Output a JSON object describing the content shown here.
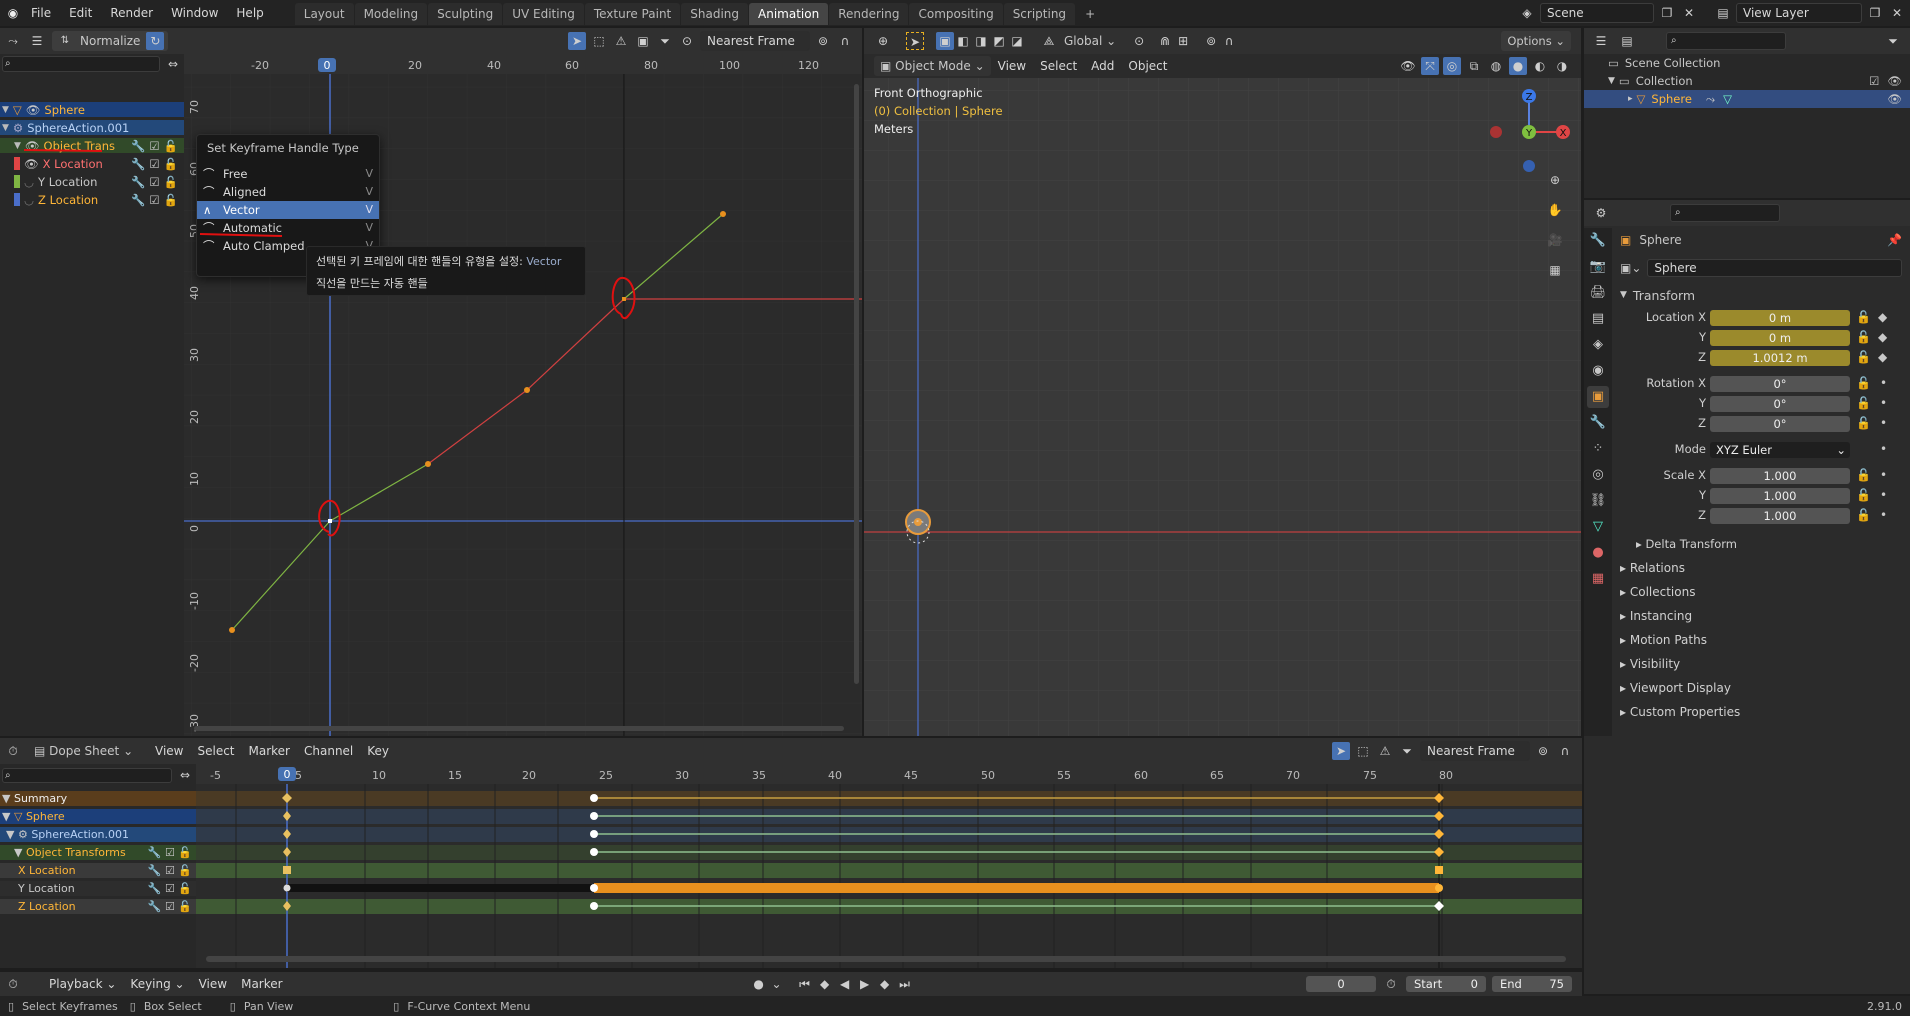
{
  "topbar": {
    "menus": [
      "File",
      "Edit",
      "Render",
      "Window",
      "Help"
    ],
    "workspaces": [
      "Layout",
      "Modeling",
      "Sculpting",
      "UV Editing",
      "Texture Paint",
      "Shading",
      "Animation",
      "Rendering",
      "Compositing",
      "Scripting"
    ],
    "active_workspace": "Animation",
    "add_tab": "+",
    "scene_label": "Scene",
    "view_layer_label": "View Layer"
  },
  "graph_editor": {
    "normalize_label": "Normalize",
    "snap_label": "Nearest Frame",
    "x_ticks": [
      "-20",
      "0",
      "20",
      "40",
      "60",
      "80",
      "100",
      "120"
    ],
    "y_ticks": [
      "70",
      "60",
      "50",
      "40",
      "30",
      "20",
      "10",
      "0",
      "-10",
      "-20",
      "-30"
    ],
    "current_frame": "0",
    "channels": [
      {
        "label": "Sphere",
        "color": "#ffb638",
        "level": 0
      },
      {
        "label": "SphereAction.001",
        "color": "#9fc6f5",
        "level": 1
      },
      {
        "label": "Object Trans",
        "color": "#ffb638",
        "level": 2
      },
      {
        "label": "X Location",
        "color": "#ff7070",
        "level": 3
      },
      {
        "label": "Y Location",
        "color": "#d0d0d0",
        "level": 3
      },
      {
        "label": "Z Location",
        "color": "#ffb638",
        "level": 3
      }
    ]
  },
  "context_menu": {
    "title": "Set Keyframe Handle Type",
    "items": [
      {
        "label": "Free",
        "shortcut": "V"
      },
      {
        "label": "Aligned",
        "shortcut": "V"
      },
      {
        "label": "Vector",
        "shortcut": "V"
      },
      {
        "label": "Automatic",
        "shortcut": "V"
      },
      {
        "label": "Auto Clamped",
        "shortcut": "V"
      }
    ],
    "active": "Vector"
  },
  "tooltip": {
    "line1": "선택된 키 프레임에 대한 핸들의 유형을 설정:",
    "line1_value": "Vector",
    "line2": "직선을 만드는 자동 핸들"
  },
  "viewport": {
    "mode": "Object Mode",
    "menus": [
      "View",
      "Select",
      "Add",
      "Object"
    ],
    "orientation": "Global",
    "info_view": "Front Orthographic",
    "info_collection": "(0) Collection | Sphere",
    "info_units": "Meters",
    "options": "Options"
  },
  "outliner": {
    "scene_collection": "Scene Collection",
    "collection": "Collection",
    "object": "Sphere"
  },
  "properties": {
    "object_name": "Sphere",
    "datablock": "Sphere",
    "transform_header": "Transform",
    "location": {
      "label_x": "Location X",
      "label_y": "Y",
      "label_z": "Z",
      "x": "0 m",
      "y": "0 m",
      "z": "1.0012 m"
    },
    "rotation": {
      "label_x": "Rotation X",
      "label_y": "Y",
      "label_z": "Z",
      "x": "0°",
      "y": "0°",
      "z": "0°"
    },
    "mode_label": "Mode",
    "mode_value": "XYZ Euler",
    "scale": {
      "label_x": "Scale X",
      "label_y": "Y",
      "label_z": "Z",
      "x": "1.000",
      "y": "1.000",
      "z": "1.000"
    },
    "delta": "Delta Transform",
    "panels": [
      "Relations",
      "Collections",
      "Instancing",
      "Motion Paths",
      "Visibility",
      "Viewport Display",
      "Custom Properties"
    ]
  },
  "dopesheet": {
    "mode": "Dope Sheet",
    "menus": [
      "View",
      "Select",
      "Marker",
      "Channel",
      "Key"
    ],
    "snap": "Nearest Frame",
    "ticks": [
      "-5",
      "0",
      "5",
      "10",
      "15",
      "20",
      "25",
      "30",
      "35",
      "40",
      "45",
      "50",
      "55",
      "60",
      "65",
      "70",
      "75",
      "80"
    ],
    "current_frame": "0",
    "channels": [
      "Summary",
      "Sphere",
      "SphereAction.001",
      "Object Transforms",
      "X Location",
      "Y Location",
      "Z Location"
    ]
  },
  "timeline": {
    "playback": "Playback",
    "keying": "Keying",
    "view": "View",
    "marker": "Marker",
    "frame": "0",
    "start_label": "Start",
    "start": "0",
    "end_label": "End",
    "end": "75"
  },
  "statusbar": {
    "select": "Select Keyframes",
    "box": "Box Select",
    "pan": "Pan View",
    "context": "F-Curve Context Menu",
    "version": "2.91.0"
  },
  "colors": {
    "accent": "#4772b3",
    "orange": "#e8901e",
    "x_curve": "#e04545",
    "z_curve": "#7fb543"
  }
}
